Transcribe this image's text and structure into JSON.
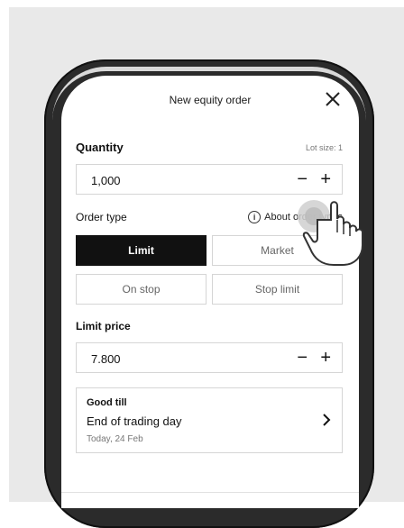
{
  "header": {
    "title": "New equity order"
  },
  "quantity": {
    "label": "Quantity",
    "lot_size": "Lot size: 1",
    "value": "1,000",
    "minus": "−",
    "plus": "+"
  },
  "order_type": {
    "label": "Order type",
    "about_link": "About order types",
    "info_glyph": "i",
    "options": [
      "Limit",
      "Market",
      "On stop",
      "Stop limit"
    ],
    "selected": "Limit"
  },
  "limit_price": {
    "label": "Limit price",
    "value": "7.800",
    "minus": "−",
    "plus": "+"
  },
  "good_till": {
    "label": "Good till",
    "value": "End of trading day",
    "date": "Today, 24 Feb"
  },
  "icons": {
    "close": "close-icon",
    "info": "info-icon",
    "chevron": "chevron-right-icon",
    "pointer": "pointer-hand-icon"
  },
  "colors": {
    "active_segment": "#111111",
    "backdrop": "#e9e9e9",
    "phone_frame": "#2b2b2b"
  }
}
